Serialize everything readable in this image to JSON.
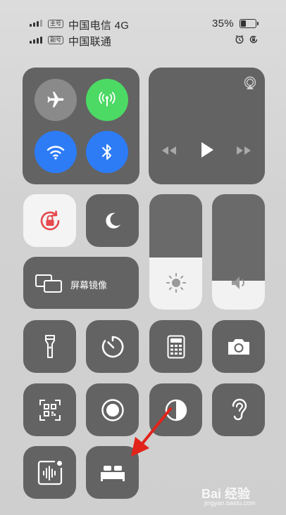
{
  "status_bar": {
    "sim1_badge": "主号",
    "sim1_carrier": "中国电信 4G",
    "sim2_badge": "副号",
    "sim2_carrier": "中国联通",
    "battery_percent": "35%",
    "battery_level": 0.35
  },
  "screen_mirroring": {
    "label": "屏幕镜像"
  },
  "brightness_level": 0.45,
  "volume_level": 0.25,
  "colors": {
    "tile": "#636363",
    "airplane_off": "#8a8a8a",
    "cellular_on": "#4cd964",
    "wifi_on": "#2d7cf6",
    "bluetooth_on": "#2d7cf6",
    "rotation_lock_red": "#e5484d",
    "arrow_red": "#e2231a"
  },
  "watermark": {
    "text": "Bai 经验",
    "sub": "jingyan.baidu.com"
  }
}
